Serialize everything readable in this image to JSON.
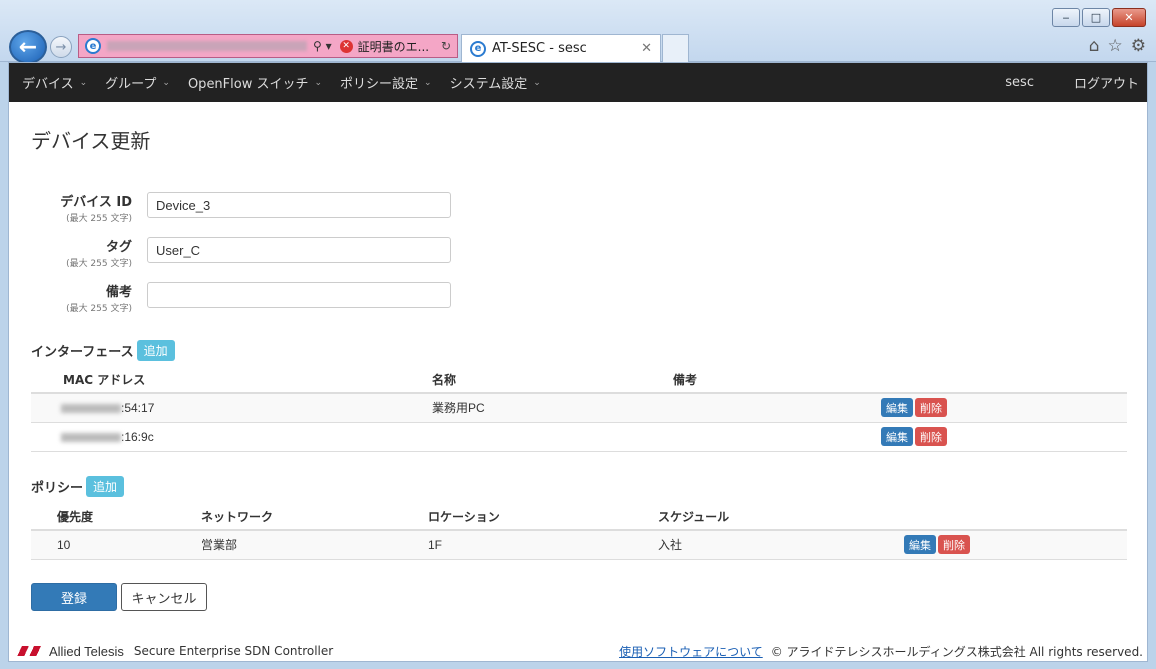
{
  "browser": {
    "cert_error": "証明書のエ...",
    "tab_title": "AT-SESC - sesc"
  },
  "nav": {
    "items": [
      {
        "label": "デバイス"
      },
      {
        "label": "グループ"
      },
      {
        "label": "OpenFlow スイッチ"
      },
      {
        "label": "ポリシー設定"
      },
      {
        "label": "システム設定"
      }
    ],
    "user": "sesc",
    "logout": "ログアウト"
  },
  "page_title": "デバイス更新",
  "form": {
    "device_id": {
      "label": "デバイス ID",
      "hint": "(最大 255 文字)",
      "value": "Device_3"
    },
    "tag": {
      "label": "タグ",
      "hint": "(最大 255 文字)",
      "value": "User_C"
    },
    "note": {
      "label": "備考",
      "hint": "(最大 255 文字)",
      "value": ""
    }
  },
  "interfaces": {
    "label": "インターフェース",
    "add": "追加",
    "columns": [
      "MAC アドレス",
      "名称",
      "備考"
    ],
    "rows": [
      {
        "mac": ":54:17",
        "name": "業務用PC",
        "note": ""
      },
      {
        "mac": ":16:9c",
        "name": "",
        "note": ""
      }
    ]
  },
  "policy": {
    "label": "ポリシー",
    "add": "追加",
    "columns": [
      "優先度",
      "ネットワーク",
      "ロケーション",
      "スケジュール"
    ],
    "rows": [
      {
        "priority": "10",
        "network": "営業部",
        "location": "1F",
        "schedule": "入社"
      }
    ]
  },
  "row_actions": {
    "edit": "編集",
    "delete": "削除"
  },
  "buttons": {
    "submit": "登録",
    "cancel": "キャンセル"
  },
  "footer": {
    "company_logo": "Allied Telesis",
    "product": "Secure Enterprise SDN Controller",
    "link": "使用ソフトウェアについて",
    "copyright": "© アライドテレシスホールディングス株式会社 All rights reserved."
  },
  "colors": {
    "navbar": "#222222",
    "primary": "#337ab7",
    "info": "#5bc0de",
    "danger": "#d9534f"
  }
}
